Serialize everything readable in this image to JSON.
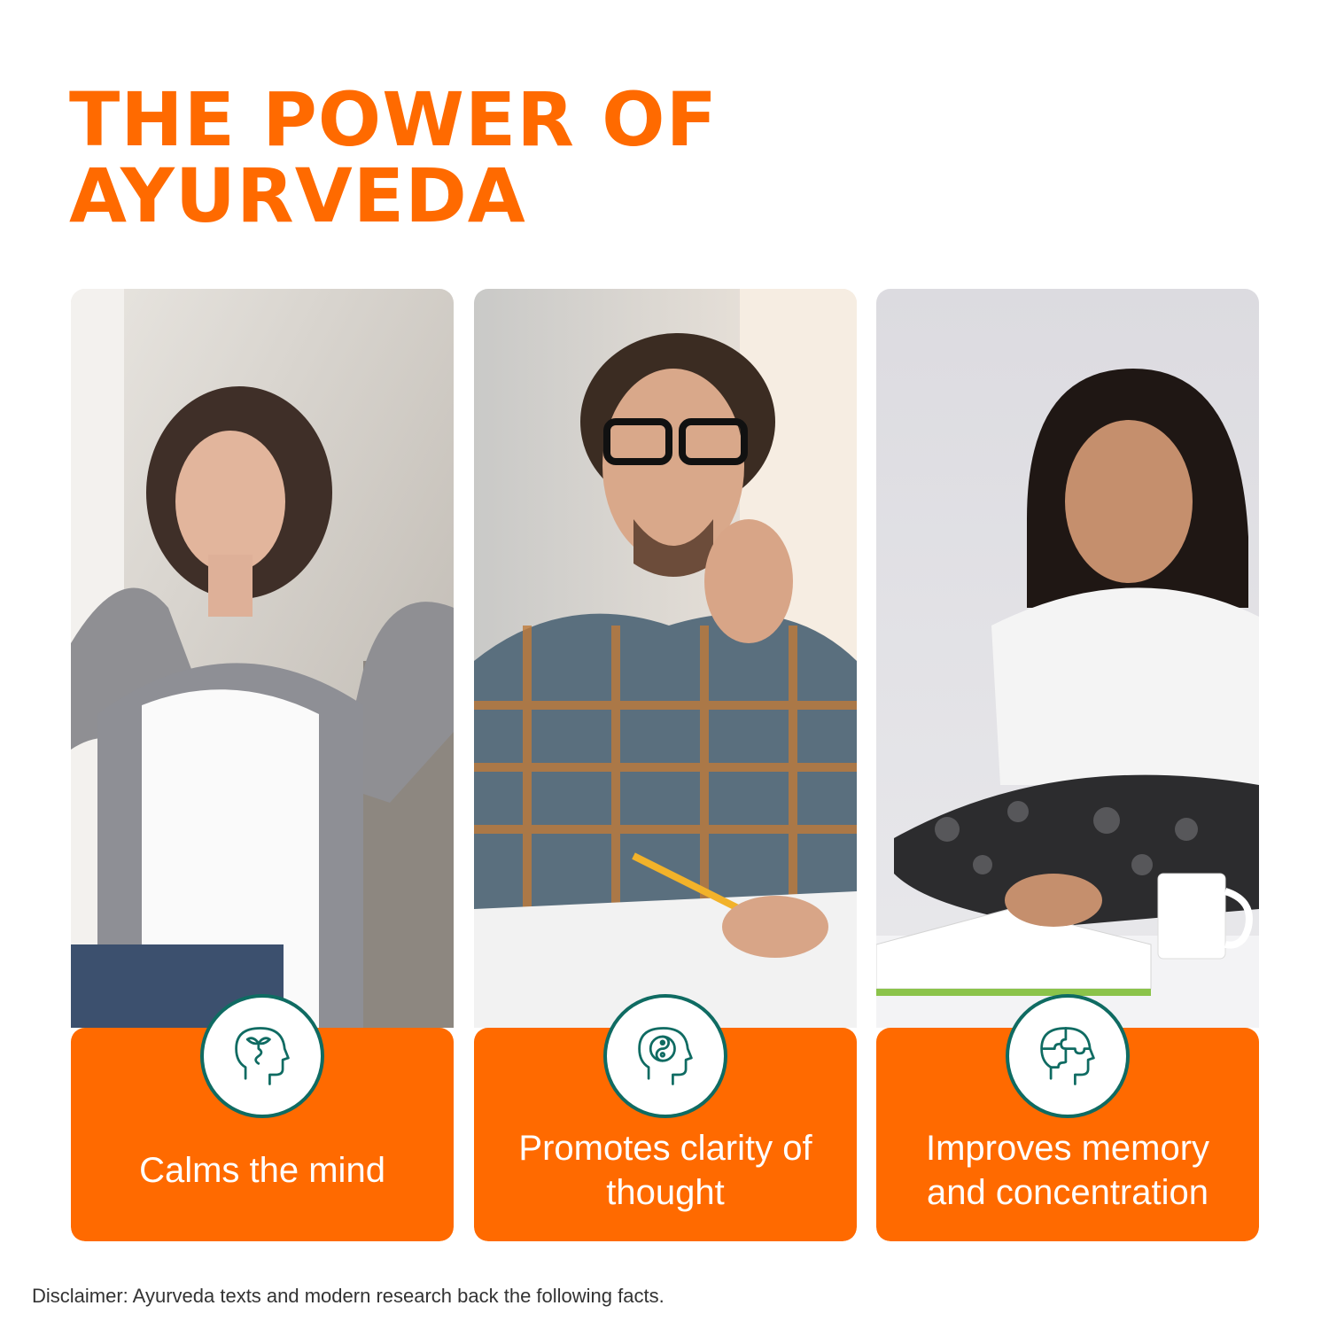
{
  "title": {
    "line1": "THE POWER OF",
    "line2": "AYURVEDA"
  },
  "colors": {
    "accent": "#ff6a00",
    "icon_stroke": "#0f6b62",
    "caption_text": "#ffffff"
  },
  "cards": [
    {
      "icon": "head-sprout-icon",
      "caption": "Calms the mind"
    },
    {
      "icon": "head-yin-yang-icon",
      "caption": "Promotes clarity of thought"
    },
    {
      "icon": "head-puzzle-icon",
      "caption": "Improves memory and concentration"
    }
  ],
  "disclaimer": "Disclaimer: Ayurveda texts and modern research back the following facts."
}
